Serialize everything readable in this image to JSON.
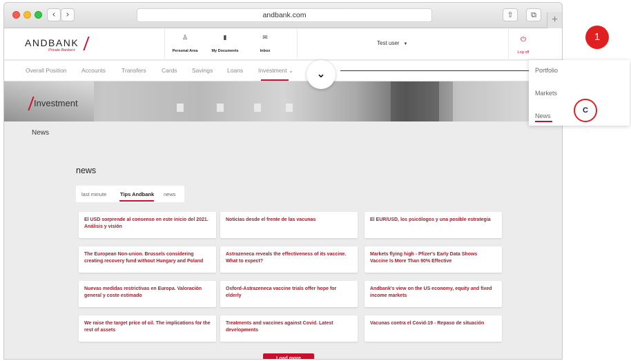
{
  "browser": {
    "url": "andbank.com",
    "back_glyph": "‹",
    "forward_glyph": "›",
    "share_glyph": "⇧",
    "tabs_glyph": "⧉",
    "new_tab_glyph": "+"
  },
  "site": {
    "logo_text": "ANDBANK",
    "logo_subtext": "Private Bankers",
    "header_links": [
      {
        "label": "Personal Area",
        "icon": "person-icon",
        "glyph": "♙"
      },
      {
        "label": "My Documents",
        "icon": "document-icon",
        "glyph": "▮"
      },
      {
        "label": "Inbox",
        "icon": "mail-icon",
        "glyph": "✉"
      }
    ],
    "user_name": "Test user",
    "user_caret": "▼",
    "logoff_label": "Log off",
    "logoff_glyph": "⏻",
    "brand_color": "#c8102e"
  },
  "nav": {
    "items": [
      "Overall Position",
      "Accounts",
      "Transfers",
      "Cards",
      "Savings",
      "Loans",
      "Investment ⌄"
    ],
    "active": "Investment ⌄"
  },
  "banner": {
    "title": "Investment"
  },
  "content": {
    "breadcrumb": "News",
    "section_title": "news",
    "subtabs": [
      "last minute",
      "Tips Andbank",
      "news"
    ],
    "active_subtab": "Tips Andbank",
    "articles": [
      "El USD sorprende al consenso en este inicio del 2021. Análisis y visión",
      "Noticias desde el frente de las vacunas",
      "El EUR/USD, los psicólogos y una posible estrategia",
      "The European Non-union. Brussels considering creating recovery fund without Hungary and Poland",
      "Astrazeneca reveals the effectiveness of its vaccine. What to expect?",
      "Markets flying high - Pfizer's Early Data Shows Vaccine Is More Than 90% Effective",
      "Nuevas medidas restrictivas en Europa. Valoración general y coste estimado",
      "Oxford-Astrazeneca vaccine trials offer hope for elderly",
      "Andbank's view on the US economy, equity and fixed income markets",
      "We raise the target price of oil. The implications for the rest of assets",
      "Treatments and vaccines against Covid. Latest developments",
      "Vacunas contra el Covid-19 - Repaso de situación"
    ],
    "load_more": "Load more"
  },
  "overlay": {
    "chevron_glyph": "⌄",
    "dropdown_items": [
      "Portfolio",
      "Markets",
      "News"
    ],
    "dropdown_active": "News",
    "step_badge": "1",
    "option_badge": "C"
  }
}
